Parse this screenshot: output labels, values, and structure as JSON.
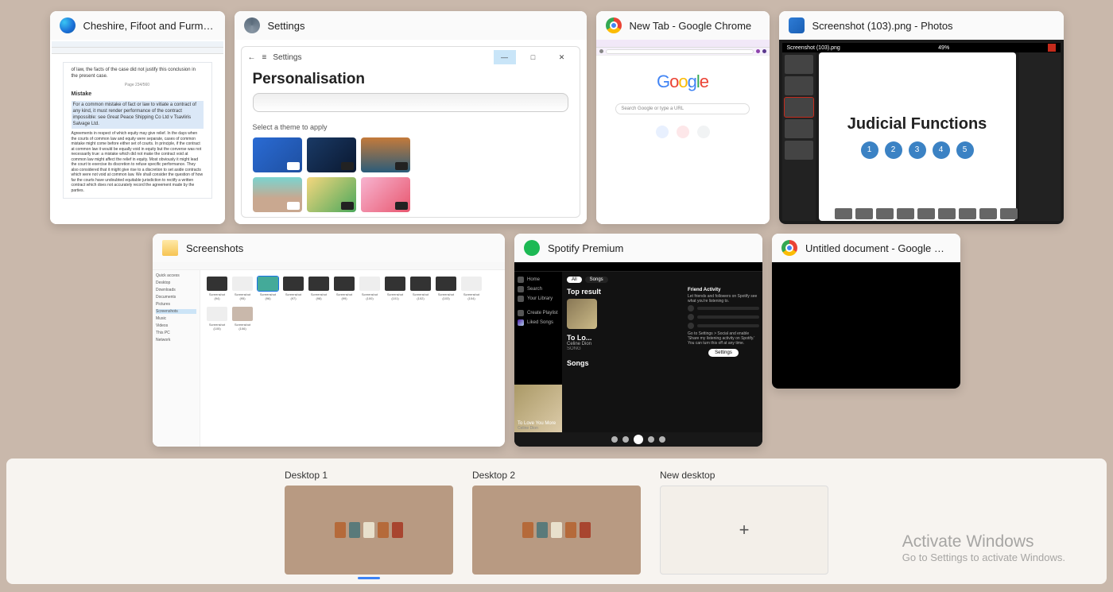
{
  "windows": {
    "edge": {
      "title": "Cheshire, Fifoot and Furmsto...",
      "doc": {
        "line1": "of law, the facts of the case did not justify this conclusion in the present case.",
        "page": "Page 234/560",
        "heading": "Mistake",
        "hl1": "For a common mistake of fact or law to vitiate a contract of any kind, it must render performance of the contract impossible: see Great Peace Shipping Co Ltd v Tsavliris Salvage Ltd.",
        "para": "Agreements in respect of which equity may give relief. In the days when the courts of common law and equity were separate, cases of common mistake might come before either set of courts. In principle, if the contract at common law it would be equally void in equity but the converse was not necessarily true: a mistake which did not make the contract void at common law might affect the relief in equity. Most obviously it might lead the court to exercise its discretion to refuse specific performance. They also considered that it might give rise to a discretion to set aside contracts which were not void at common law. We shall consider the question of how far the courts have undoubted equitable jurisdiction to rectify a written contract which does not accurately record the agreement made by the parties."
      }
    },
    "settings": {
      "title": "Settings",
      "frame_title": "Settings",
      "heading": "Personalisation",
      "subtitle": "Select a theme to apply"
    },
    "chrome": {
      "title": "New Tab - Google Chrome",
      "search_placeholder": "Search Google or type a URL"
    },
    "photos": {
      "title": "Screenshot (103).png - Photos",
      "bar_filename": "Screenshot (103).png",
      "zoom": "49%",
      "slide_title": "Judicial Functions",
      "circles": [
        "1",
        "2",
        "3",
        "4",
        "5"
      ]
    },
    "explorer": {
      "title": "Screenshots",
      "sidebar": [
        "Quick access",
        "Desktop",
        "Downloads",
        "Documents",
        "Pictures",
        "Screenshots",
        "Music",
        "Videos",
        "This PC",
        "Network"
      ],
      "files": [
        "Screenshot (94)",
        "Screenshot (95)",
        "Screenshot (96)",
        "Screenshot (97)",
        "Screenshot (98)",
        "Screenshot (99)",
        "Screenshot (100)",
        "Screenshot (101)",
        "Screenshot (102)",
        "Screenshot (103)",
        "Screenshot (104)",
        "Screenshot (105)",
        "Screenshot (106)"
      ]
    },
    "spotify": {
      "title": "Spotify Premium",
      "sidebar": [
        "Home",
        "Search",
        "Your Library",
        "Create Playlist",
        "Liked Songs"
      ],
      "pills": [
        "All",
        "Songs"
      ],
      "top_result": "Top result",
      "result_title": "To Lo...",
      "result_artist": "Celine Dion",
      "result_type": "SONG",
      "songs_heading": "Songs",
      "fa_title": "Friend Activity",
      "fa_sub": "Let friends and followers on Spotify see what you're listening to.",
      "fa_cta": "Go to Settings > Social and enable 'Share my listening activity on Spotify.' You can turn this off at any time.",
      "fa_button": "Settings",
      "now_playing": "To Love You More",
      "now_artist": "Celine Dion"
    },
    "docs": {
      "title": "Untitled document - Google Do..."
    }
  },
  "desktops": {
    "d1": "Desktop 1",
    "d2": "Desktop 2",
    "new": "New desktop"
  },
  "watermark": {
    "line1": "Activate Windows",
    "line2": "Go to Settings to activate Windows."
  }
}
